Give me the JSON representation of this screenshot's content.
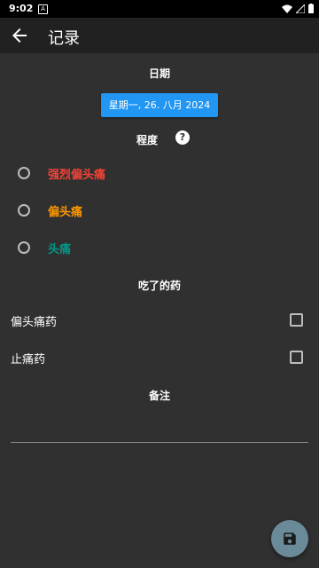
{
  "status_bar": {
    "time": "9:02",
    "notification_icon": "A"
  },
  "app_bar": {
    "title": "记录",
    "back_icon": "arrow-left-icon"
  },
  "date_section": {
    "label": "日期",
    "date_button": "星期一, 26. 八月 2024"
  },
  "severity": {
    "label": "程度",
    "help_icon": "?",
    "options": [
      {
        "label": "强烈偏头痛",
        "color": "#f44336"
      },
      {
        "label": "偏头痛",
        "color": "#ff9800"
      },
      {
        "label": "头痛",
        "color": "#009688"
      }
    ]
  },
  "medicine": {
    "label": "吃了的药",
    "items": [
      {
        "label": "偏头痛药"
      },
      {
        "label": "止痛药"
      }
    ]
  },
  "notes": {
    "label": "备注",
    "value": ""
  },
  "fab": {
    "icon": "save-icon"
  }
}
